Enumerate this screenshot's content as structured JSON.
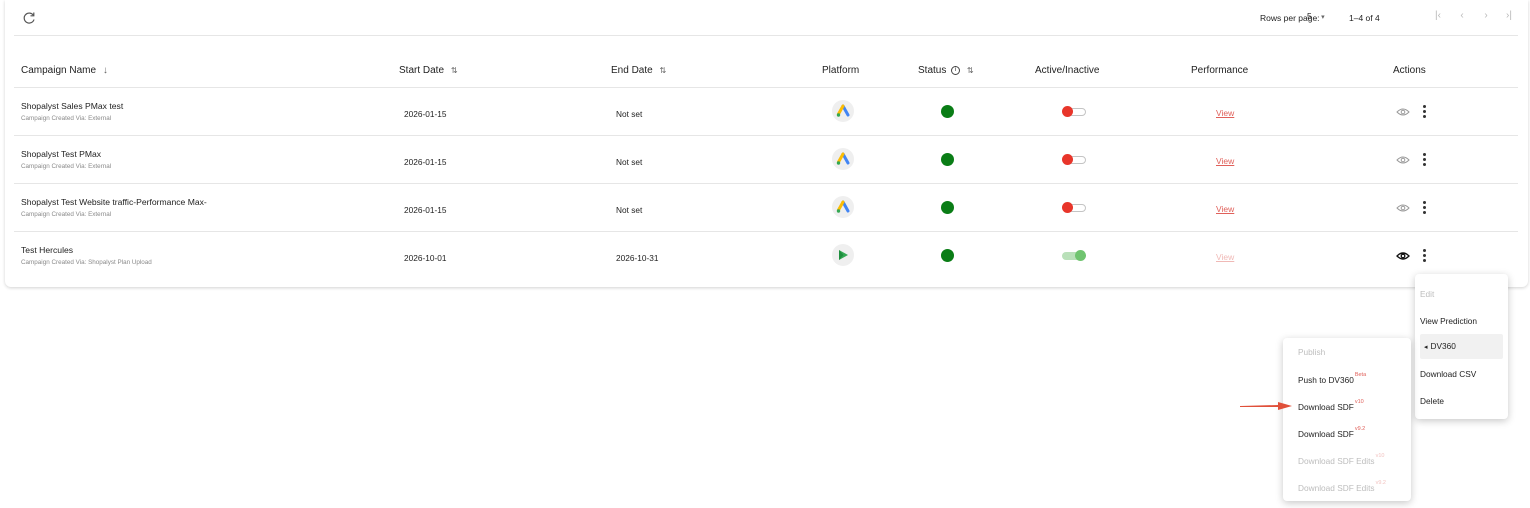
{
  "toolbar": {
    "rows_per_page_label": "Rows per page:",
    "rows_per_page_value": "5",
    "page_range": "1–4 of 4",
    "first_page": "|‹",
    "prev_page": "‹",
    "next_page": "›",
    "last_page": "›|"
  },
  "columns": {
    "name": "Campaign Name",
    "start": "Start Date",
    "end": "End Date",
    "platform": "Platform",
    "status": "Status",
    "active": "Active/Inactive",
    "performance": "Performance",
    "actions": "Actions"
  },
  "rows": [
    {
      "name": "Shopalyst Sales PMax test",
      "sub": "Campaign Created Via: External",
      "start": "2026-01-15",
      "end": "Not set",
      "platform": "google-ads-icon",
      "active": false,
      "perf": "View"
    },
    {
      "name": "Shopalyst Test PMax",
      "sub": "Campaign Created Via: External",
      "start": "2026-01-15",
      "end": "Not set",
      "platform": "google-ads-icon",
      "active": false,
      "perf": "View"
    },
    {
      "name": "Shopalyst Test Website traffic-Performance Max-",
      "sub": "Campaign Created Via: External",
      "start": "2026-01-15",
      "end": "Not set",
      "platform": "google-ads-icon",
      "active": false,
      "perf": "View"
    },
    {
      "name": "Test Hercules",
      "sub": "Campaign Created Via: Shopalyst Plan Upload",
      "start": "2026-10-01",
      "end": "2026-10-31",
      "platform": "dv360-icon",
      "active": true,
      "perf": "View"
    }
  ],
  "actions_menu": {
    "edit": "Edit",
    "view_prediction": "View Prediction",
    "dv360_caret": "◂",
    "dv360": "DV360",
    "download_csv": "Download CSV",
    "delete": "Delete"
  },
  "dv360_submenu": {
    "publish": "Publish",
    "push": "Push to DV360",
    "push_badge": "Beta",
    "sdf1": "Download SDF",
    "sdf1_badge": "v10",
    "sdf2": "Download SDF",
    "sdf2_badge": "v9.2",
    "edits1": "Download SDF Edits",
    "edits1_badge": "v10",
    "edits2": "Download SDF Edits",
    "edits2_badge": "v9.2"
  },
  "colors": {
    "status_active": "#0a7d16",
    "toggle_off": "#e8352a",
    "toggle_on": "#6fc46f",
    "link": "#e0605a",
    "arrow": "#e0503a"
  }
}
